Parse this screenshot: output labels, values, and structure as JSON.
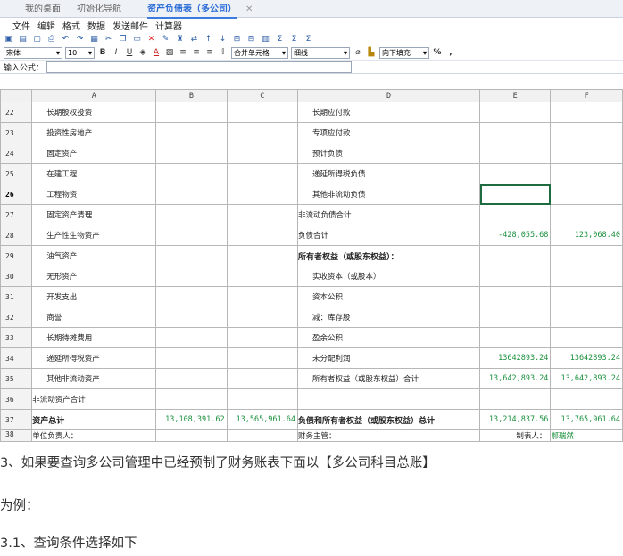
{
  "tabs": [
    {
      "label": "我的桌面"
    },
    {
      "label": "初始化导航"
    },
    {
      "label": "资产负债表（多公司）"
    }
  ],
  "menu": [
    "文件",
    "编辑",
    "格式",
    "数据",
    "发送邮件",
    "计算器"
  ],
  "toolbar": {
    "font": "宋体",
    "size": "10",
    "merge": "合并单元格",
    "border": "细线",
    "fill": "向下填充",
    "percent": "%",
    "comma": ","
  },
  "formula_label": "输入公式：",
  "columns": [
    "A",
    "B",
    "C",
    "D",
    "E",
    "F"
  ],
  "rows": [
    {
      "n": "22",
      "a": "长期股权投资",
      "b": "",
      "c": "",
      "d": "长期应付款",
      "e": "",
      "f": ""
    },
    {
      "n": "23",
      "a": "投资性房地产",
      "b": "",
      "c": "",
      "d": "专项应付款",
      "e": "",
      "f": ""
    },
    {
      "n": "24",
      "a": "固定资产",
      "b": "",
      "c": "",
      "d": "预计负债",
      "e": "",
      "f": ""
    },
    {
      "n": "25",
      "a": "在建工程",
      "b": "",
      "c": "",
      "d": "递延所得税负债",
      "e": "",
      "f": ""
    },
    {
      "n": "26",
      "a": "工程物资",
      "b": "",
      "c": "",
      "d": "其他非流动负债",
      "e": "",
      "f": ""
    },
    {
      "n": "27",
      "a": "固定资产清理",
      "b": "",
      "c": "",
      "d": "非流动负债合计",
      "e": "",
      "f": ""
    },
    {
      "n": "28",
      "a": "生产性生物资产",
      "b": "",
      "c": "",
      "d": "负债合计",
      "e": "-428,055.68",
      "f": "123,068.40"
    },
    {
      "n": "29",
      "a": "油气资产",
      "b": "",
      "c": "",
      "d": "所有者权益（或股东权益）：",
      "e": "",
      "f": ""
    },
    {
      "n": "30",
      "a": "无形资产",
      "b": "",
      "c": "",
      "d": "实收资本（或股本）",
      "e": "",
      "f": ""
    },
    {
      "n": "31",
      "a": "开发支出",
      "b": "",
      "c": "",
      "d": "资本公积",
      "e": "",
      "f": ""
    },
    {
      "n": "32",
      "a": "商誉",
      "b": "",
      "c": "",
      "d": "减：库存股",
      "e": "",
      "f": ""
    },
    {
      "n": "33",
      "a": "长期待摊费用",
      "b": "",
      "c": "",
      "d": "盈余公积",
      "e": "",
      "f": ""
    },
    {
      "n": "34",
      "a": "递延所得税资产",
      "b": "",
      "c": "",
      "d": "未分配利润",
      "e": "13642893.24",
      "f": "13642893.24"
    },
    {
      "n": "35",
      "a": "其他非流动资产",
      "b": "",
      "c": "",
      "d": "所有者权益（或股东权益）合计",
      "e": "13,642,893.24",
      "f": "13,642,893.24"
    },
    {
      "n": "36",
      "a": "非流动资产合计",
      "b": "",
      "c": "",
      "d": "",
      "e": "",
      "f": ""
    },
    {
      "n": "37",
      "a": "资产总计",
      "b": "13,108,391.62",
      "c": "13,565,961.64",
      "d": "负债和所有者权益（或股东权益）总计",
      "e": "13,214,837.56",
      "f": "13,765,961.64"
    },
    {
      "n": "38",
      "a": "单位负责人：",
      "b": "",
      "c": "",
      "d": "财务主管：",
      "e": "制表人：",
      "f": "郝瑞然"
    }
  ],
  "paragraphs": [
    "3、如果要查询多公司管理中已经预制了财务账表下面以【多公司科目总账】",
    "为例：",
    "3.1、查询条件选择如下"
  ]
}
